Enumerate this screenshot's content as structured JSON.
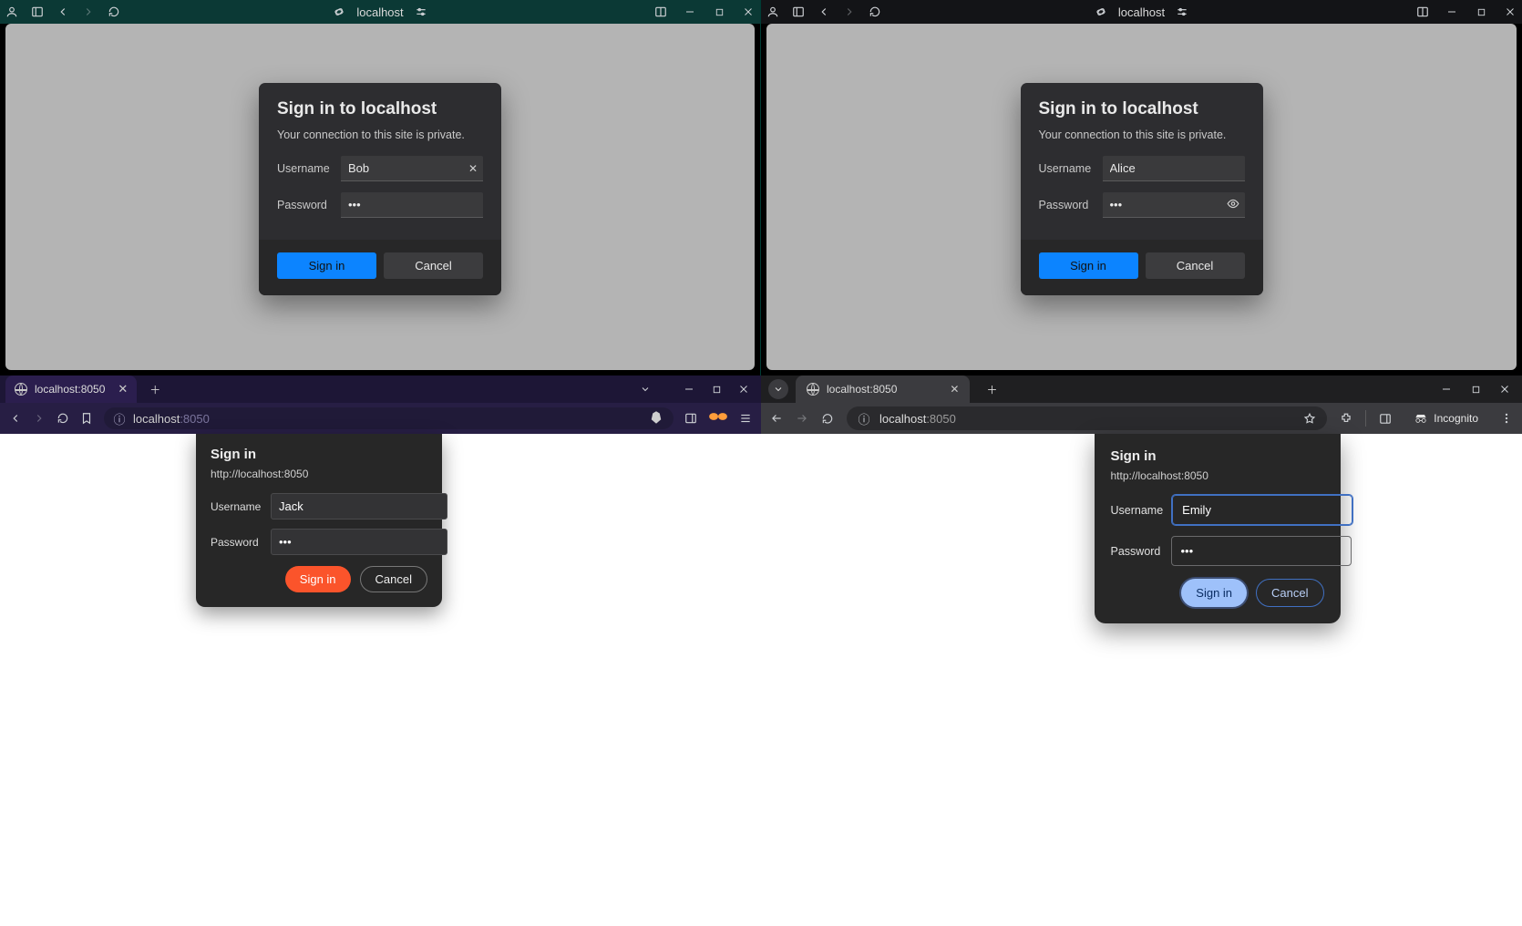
{
  "edge_left": {
    "url": "localhost",
    "dialog": {
      "title": "Sign in to localhost",
      "subtitle": "Your connection to this site is private.",
      "username_label": "Username",
      "username_value": "Bob",
      "password_label": "Password",
      "password_value": "•••",
      "signin": "Sign in",
      "cancel": "Cancel"
    }
  },
  "edge_right": {
    "url": "localhost",
    "dialog": {
      "title": "Sign in to localhost",
      "subtitle": "Your connection to this site is private.",
      "username_label": "Username",
      "username_value": "Alice",
      "password_label": "Password",
      "password_value": "•••",
      "signin": "Sign in",
      "cancel": "Cancel"
    }
  },
  "brave": {
    "tab_title": "localhost:8050",
    "url_host": "localhost",
    "url_port": ":8050",
    "dialog": {
      "title": "Sign in",
      "site": "http://localhost:8050",
      "username_label": "Username",
      "username_value": "Jack",
      "password_label": "Password",
      "password_value": "•••",
      "signin": "Sign in",
      "cancel": "Cancel"
    }
  },
  "chrome": {
    "tab_title": "localhost:8050",
    "url_host": "localhost",
    "url_port": ":8050",
    "incognito_label": "Incognito",
    "dialog": {
      "title": "Sign in",
      "site": "http://localhost:8050",
      "username_label": "Username",
      "username_value": "Emily",
      "password_label": "Password",
      "password_value": "•••",
      "signin": "Sign in",
      "cancel": "Cancel"
    }
  }
}
